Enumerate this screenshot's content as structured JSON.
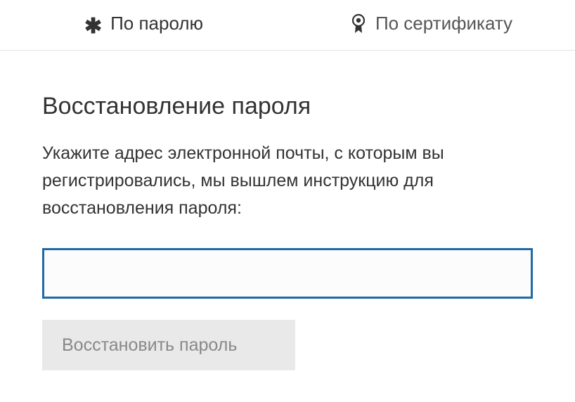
{
  "tabs": {
    "password": {
      "label": "По паролю"
    },
    "certificate": {
      "label": "По сертификату"
    }
  },
  "form": {
    "heading": "Восстановление пароля",
    "description": "Укажите адрес электронной почты, с которым вы регистрировались, мы вышлем инструкцию для восстановления пароля:",
    "email_value": "",
    "email_placeholder": "",
    "submit_label": "Восстановить пароль"
  }
}
